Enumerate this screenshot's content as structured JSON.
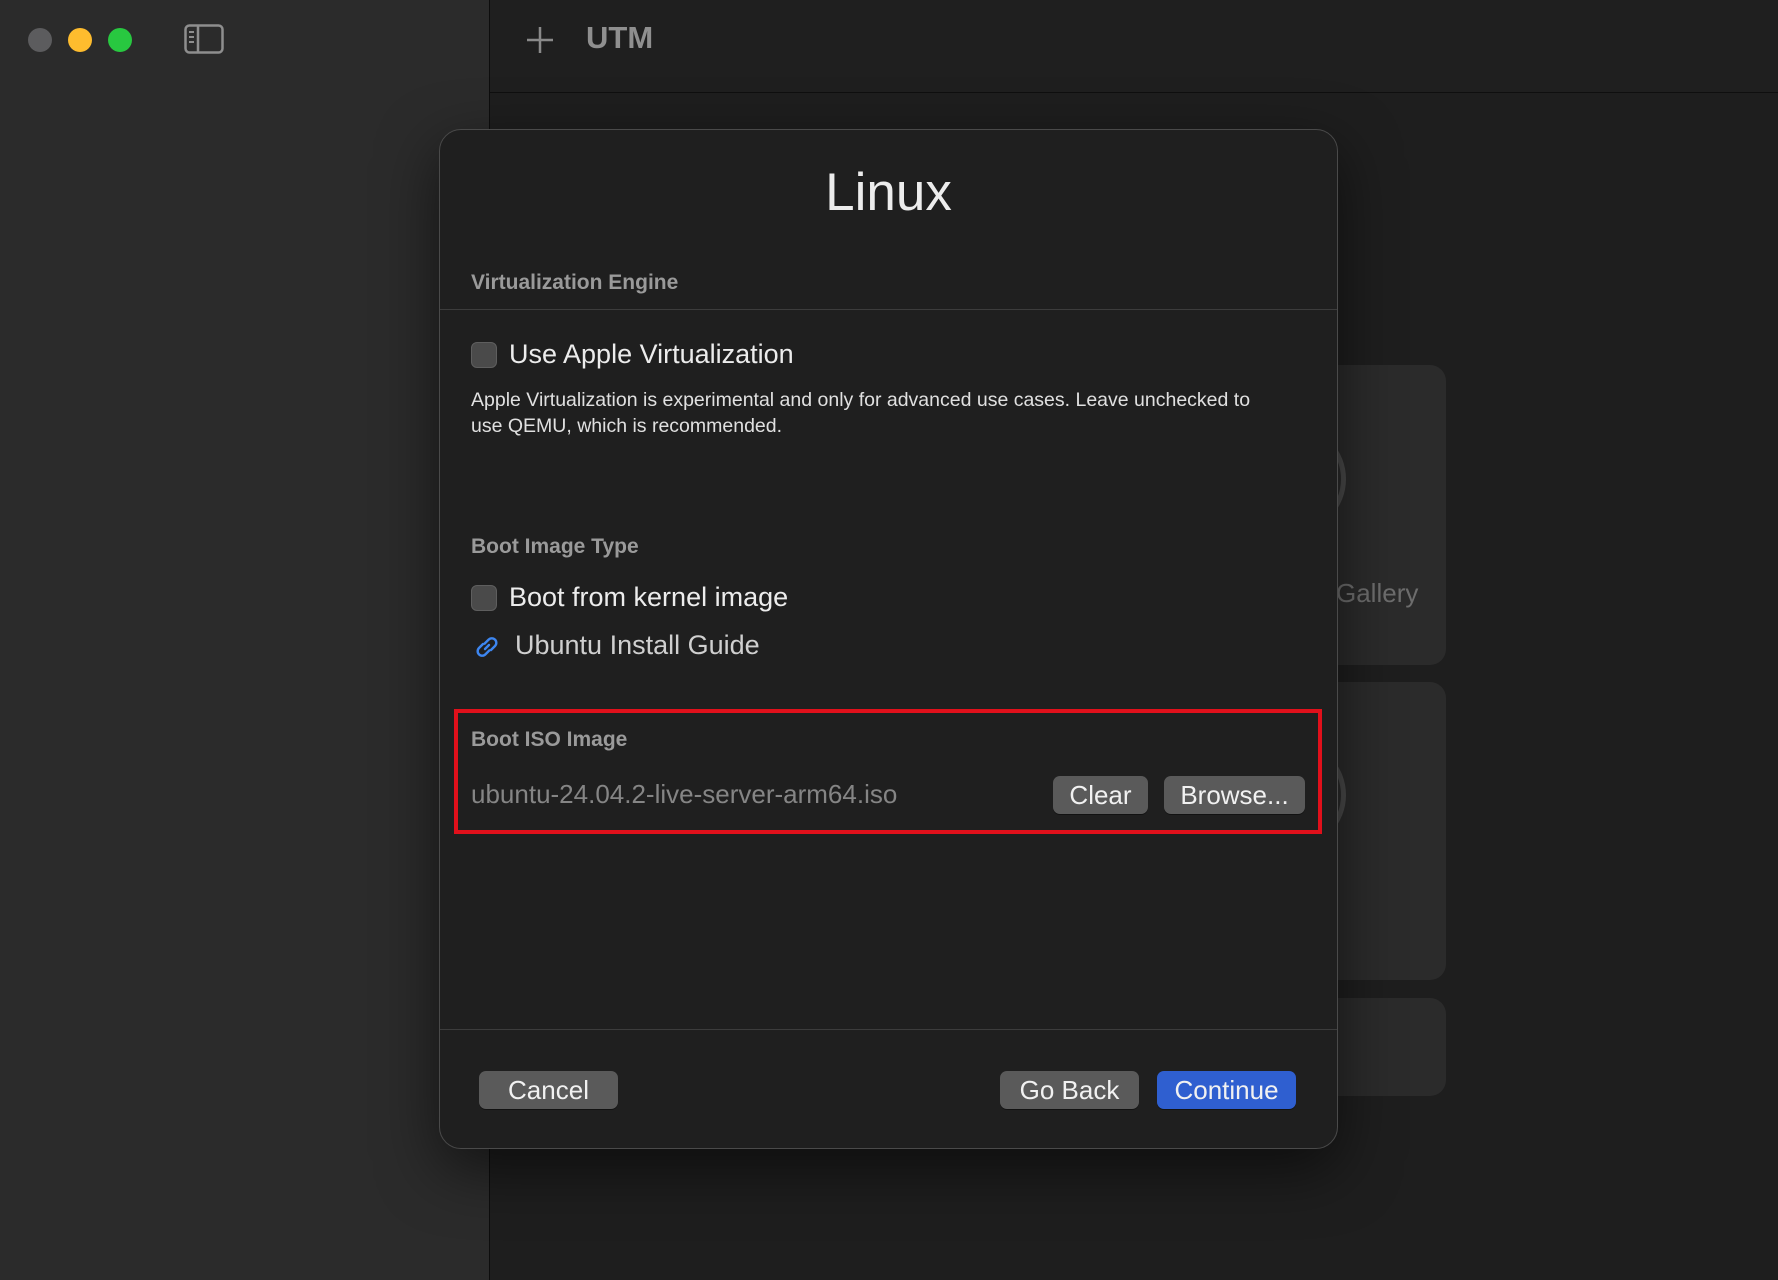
{
  "window": {
    "app_title": "UTM",
    "traffic_lights": [
      "close",
      "minimize",
      "zoom"
    ],
    "icons": {
      "sidebar_toggle": "sidebar-toggle-icon",
      "add": "plus-icon",
      "link": "link-icon"
    }
  },
  "background": {
    "gallery_text": "Gallery",
    "partial_text": "t"
  },
  "dialog": {
    "title": "Linux",
    "virtualization": {
      "label": "Virtualization Engine",
      "apple_virtualization_label": "Use Apple Virtualization",
      "apple_virtualization_checked": false,
      "description": "Apple Virtualization is experimental and only for advanced use cases. Leave unchecked to use QEMU, which is recommended."
    },
    "boot_image_type": {
      "label": "Boot Image Type",
      "kernel_label": "Boot from kernel image",
      "kernel_checked": false,
      "guide_link": "Ubuntu Install Guide"
    },
    "boot_iso": {
      "label": "Boot ISO Image",
      "value": "ubuntu-24.04.2-live-server-arm64.iso",
      "clear_label": "Clear",
      "browse_label": "Browse..."
    },
    "footer": {
      "cancel_label": "Cancel",
      "go_back_label": "Go Back",
      "continue_label": "Continue"
    }
  },
  "colors": {
    "highlight_border": "#e0101b",
    "primary_button": "#2f5fd0",
    "link_icon": "#3d86f0"
  }
}
